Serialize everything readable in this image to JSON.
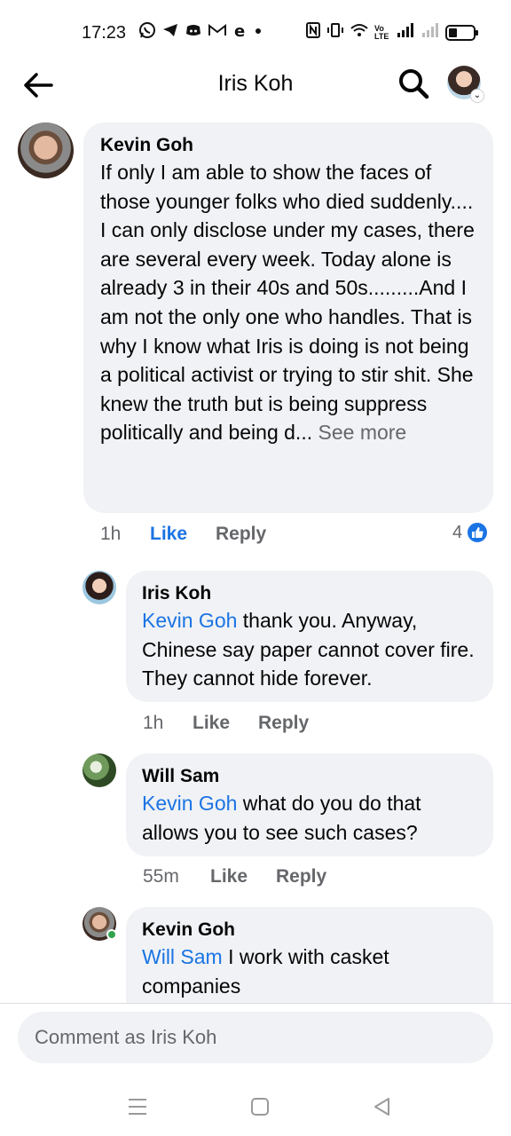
{
  "status_bar": {
    "time": "17:23",
    "network_label": "Vo LTE",
    "app_icons": [
      "whatsapp-icon",
      "telegram-icon",
      "discord-icon",
      "gmail-icon",
      "b-icon"
    ]
  },
  "header": {
    "title": "Iris Koh"
  },
  "comments": [
    {
      "author": "Kevin Goh",
      "mention": "",
      "text": "If only I am able to show the faces of those younger folks who died suddenly.... I can only disclose under my cases, there are several every week. Today alone is already 3 in their 40s and 50s.........And I am not the only one who handles. That is why I know what Iris is doing is not being a political activist or trying to stir shit. She knew the truth but is being suppress politically and being d...",
      "see_more": "See more",
      "time": "1h",
      "like_label": "Like",
      "reply_label": "Reply",
      "reaction_count": "4"
    },
    {
      "author": "Iris Koh",
      "mention": "Kevin Goh",
      "text": " thank you. Anyway, Chinese say paper cannot cover fire. They cannot hide forever.",
      "time": "1h",
      "like_label": "Like",
      "reply_label": "Reply"
    },
    {
      "author": "Will Sam",
      "mention": "Kevin Goh",
      "text": " what do you do that allows you to see such cases?",
      "time": "55m",
      "like_label": "Like",
      "reply_label": "Reply"
    },
    {
      "author": "Kevin Goh",
      "mention": "Will Sam",
      "text": " I work with casket companies"
    }
  ],
  "composer": {
    "placeholder": "Comment as Iris Koh"
  },
  "colors": {
    "accent": "#1b74e4",
    "bubble": "#f0f2f5",
    "muted": "#65676b",
    "online": "#31a24c"
  }
}
